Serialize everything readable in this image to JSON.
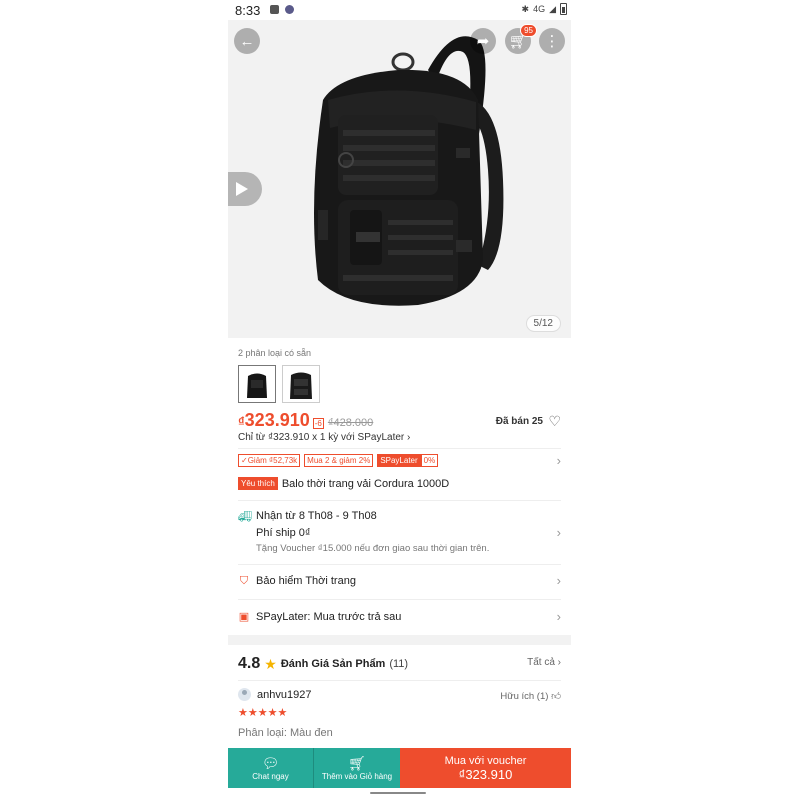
{
  "status_bar": {
    "time": "8:33",
    "network": "4G"
  },
  "hero": {
    "image_counter": "5/12",
    "cart_count": "95"
  },
  "icons": {
    "back": "arrow-left-icon",
    "share": "share-icon",
    "cart": "cart-icon",
    "more": "more-vertical-icon",
    "play": "play-icon",
    "heart": "heart-icon"
  },
  "variants": {
    "label": "2 phân loại có sẵn"
  },
  "price": {
    "currency": "₫",
    "current": "323.910",
    "discount_tag": "-6",
    "original": "₫428.000",
    "sold": "Đã bán 25",
    "spaylater_line": "Chỉ từ ₫323.910 x 1 kỳ với SPayLater ›"
  },
  "promos": {
    "chips": [
      "✓Giảm ₫52,73k",
      "Mua 2 & giảm 2%"
    ],
    "spay_label": "SPayLater",
    "spay_value": "0%"
  },
  "product": {
    "badge": "Yêu thích",
    "name": "Balo thời trang vải Cordura 1000D"
  },
  "shipping": {
    "delivery": "Nhận từ 8 Th08 - 9 Th08",
    "fee": "Phí ship 0₫",
    "voucher_note": "Tặng Voucher ₫15.000 nếu đơn giao sau thời gian trên."
  },
  "insurance": {
    "label": "Bảo hiểm Thời trang"
  },
  "spaylater_row": {
    "label": "SPayLater: Mua trước trả sau"
  },
  "ratings": {
    "score": "4.8",
    "title": "Đánh Giá Sản Phẩm",
    "count": "(11)",
    "see_all": "Tất cả ›"
  },
  "review": {
    "user": "anhvu1927",
    "helpful": "Hữu ích (1)",
    "stars": 5,
    "variant": "Phân loại: Màu đen"
  },
  "bottom_bar": {
    "chat": "Chat ngay",
    "add_cart": "Thêm vào Giỏ hàng",
    "buy_line1": "Mua với voucher",
    "buy_line2": "₫323.910"
  },
  "colors": {
    "accent": "#ee4d2d",
    "teal": "#26aa99"
  }
}
